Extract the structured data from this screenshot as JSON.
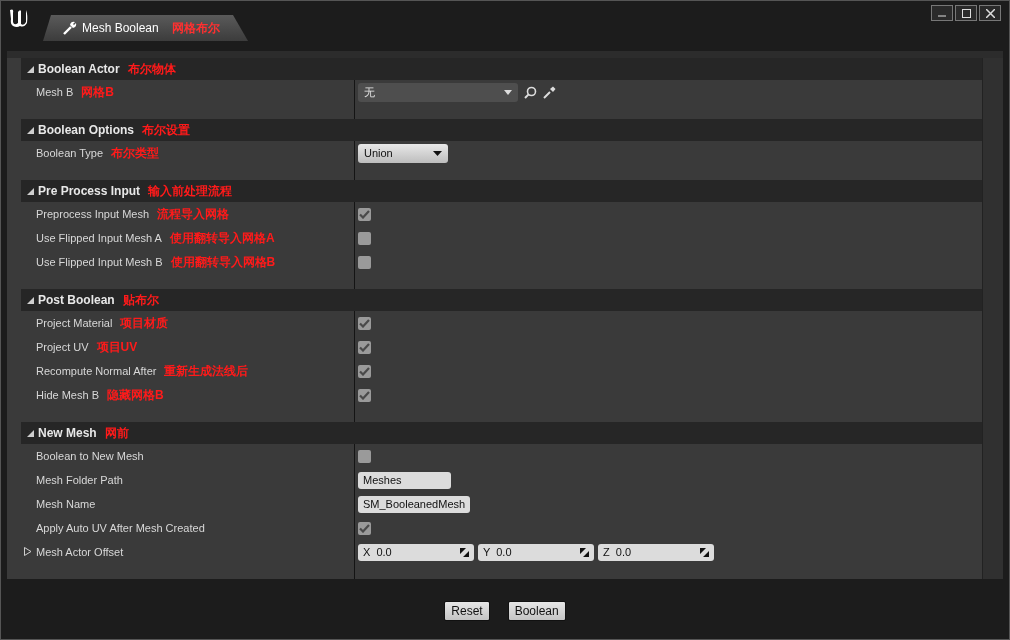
{
  "window": {
    "tab": {
      "label": "Mesh Boolean",
      "note": "网格布尔",
      "selected": true
    }
  },
  "sections": [
    {
      "title": "Boolean Actor",
      "note": "布尔物体",
      "expanded": true,
      "rows": [
        {
          "kind": "object",
          "label": "Mesh B",
          "note": "网格B",
          "value": "无"
        }
      ]
    },
    {
      "title": "Boolean Options",
      "note": "布尔设置",
      "expanded": true,
      "rows": [
        {
          "kind": "combo",
          "label": "Boolean Type",
          "note": "布尔类型",
          "value": "Union"
        }
      ]
    },
    {
      "title": "Pre Process Input",
      "note": "输入前处理流程",
      "expanded": true,
      "rows": [
        {
          "kind": "checkbox",
          "label": "Preprocess Input Mesh",
          "note": "流程导入网格",
          "checked": true
        },
        {
          "kind": "checkbox",
          "label": "Use Flipped Input Mesh A",
          "note": "使用翻转导入网格A",
          "checked": false
        },
        {
          "kind": "checkbox",
          "label": "Use Flipped Input Mesh B",
          "note": "使用翻转导入网格B",
          "checked": false
        }
      ]
    },
    {
      "title": "Post Boolean",
      "note": "贴布尔",
      "expanded": true,
      "rows": [
        {
          "kind": "checkbox",
          "label": "Project Material",
          "note": "项目材质",
          "checked": true
        },
        {
          "kind": "checkbox",
          "label": "Project UV",
          "note": "项目UV",
          "checked": true
        },
        {
          "kind": "checkbox",
          "label": "Recompute Normal After",
          "note": "重新生成法线后",
          "checked": true
        },
        {
          "kind": "checkbox",
          "label": "Hide Mesh B",
          "note": "隐藏网格B",
          "checked": true
        }
      ]
    },
    {
      "title": "New Mesh",
      "note": "网前",
      "expanded": true,
      "rows": [
        {
          "kind": "checkbox",
          "label": "Boolean to New Mesh",
          "checked": false
        },
        {
          "kind": "text",
          "label": "Mesh Folder Path",
          "value": "Meshes"
        },
        {
          "kind": "text",
          "label": "Mesh Name",
          "value": "SM_BooleanedMesh"
        },
        {
          "kind": "checkbox",
          "label": "Apply Auto UV After Mesh Created",
          "checked": true
        },
        {
          "kind": "vector",
          "label": "Mesh Actor Offset",
          "expanded": false,
          "components": [
            {
              "axis": "X",
              "value": "0.0"
            },
            {
              "axis": "Y",
              "value": "0.0"
            },
            {
              "axis": "Z",
              "value": "0.0"
            }
          ]
        }
      ]
    }
  ],
  "buttons": [
    "Reset",
    "Boolean"
  ]
}
